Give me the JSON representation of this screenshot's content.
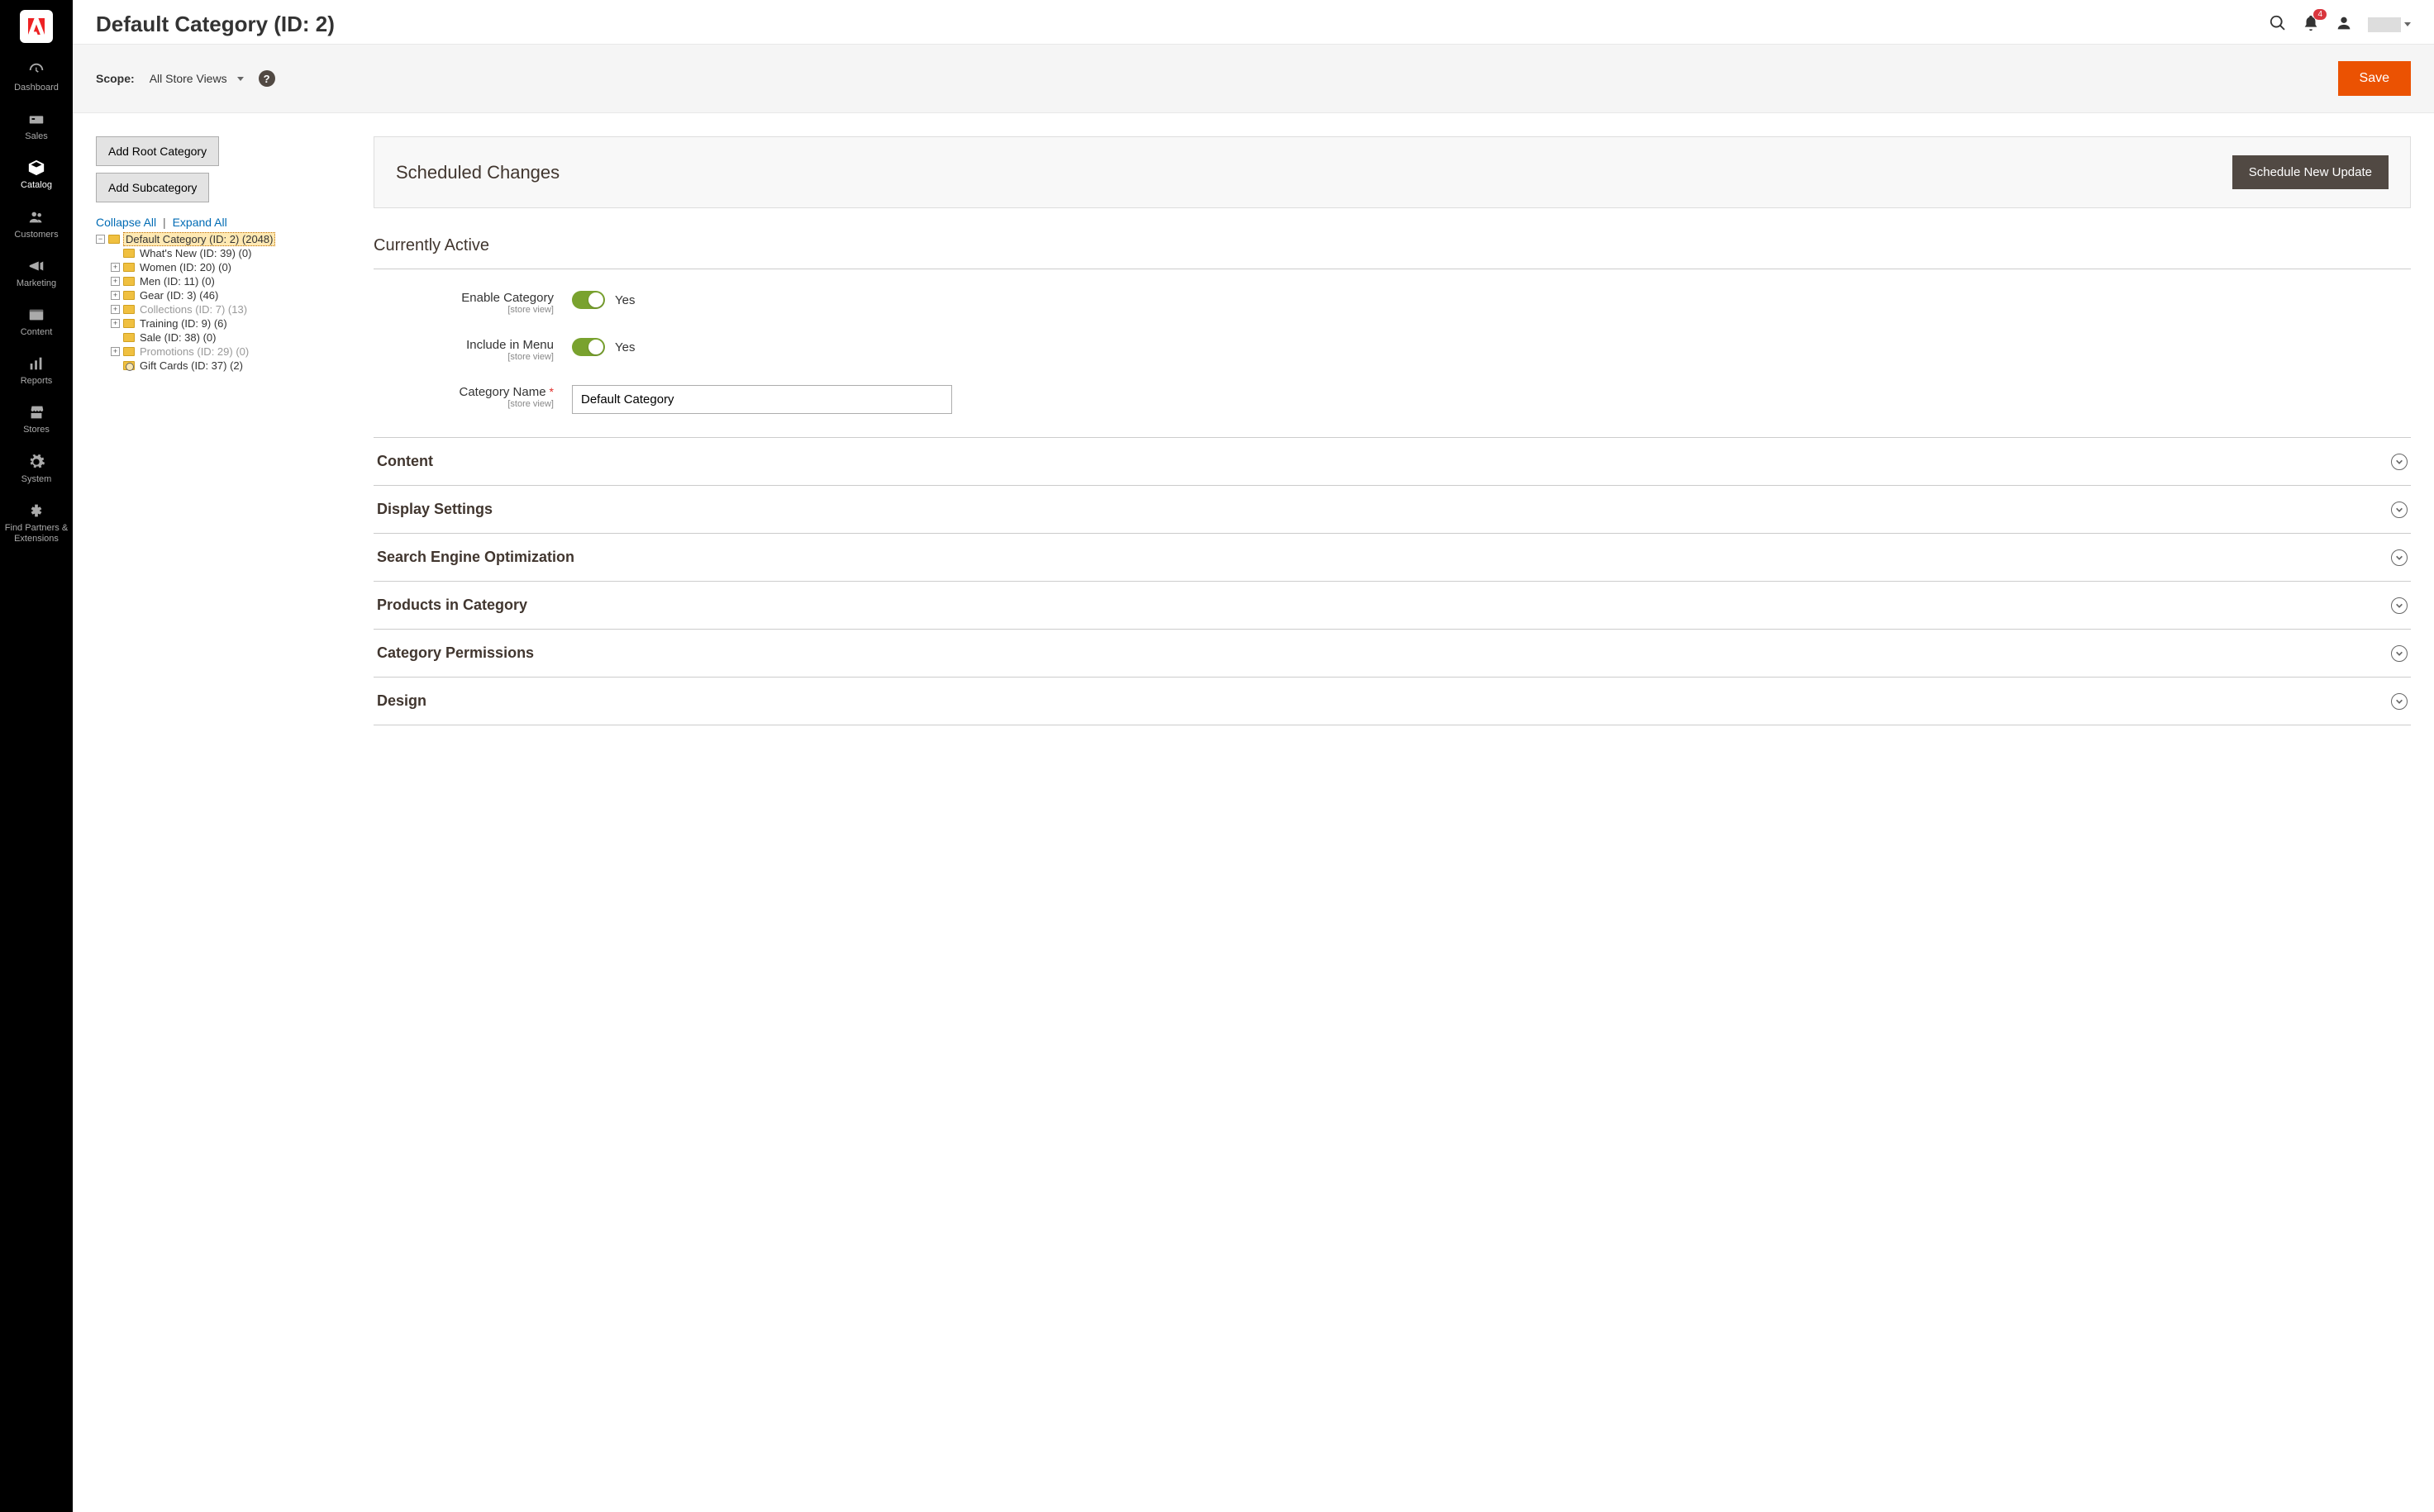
{
  "sidebar": {
    "items": [
      {
        "id": "dashboard",
        "label": "Dashboard"
      },
      {
        "id": "sales",
        "label": "Sales"
      },
      {
        "id": "catalog",
        "label": "Catalog",
        "active": true
      },
      {
        "id": "customers",
        "label": "Customers"
      },
      {
        "id": "marketing",
        "label": "Marketing"
      },
      {
        "id": "content",
        "label": "Content"
      },
      {
        "id": "reports",
        "label": "Reports"
      },
      {
        "id": "stores",
        "label": "Stores"
      },
      {
        "id": "system",
        "label": "System"
      },
      {
        "id": "partners",
        "label": "Find Partners & Extensions"
      }
    ]
  },
  "header": {
    "title": "Default Category (ID: 2)",
    "notifications_count": "4"
  },
  "scope": {
    "label": "Scope:",
    "value": "All Store Views",
    "save_label": "Save"
  },
  "tree_actions": {
    "add_root": "Add Root Category",
    "add_sub": "Add Subcategory",
    "collapse_all": "Collapse All",
    "expand_all": "Expand All"
  },
  "tree": {
    "root": {
      "label": "Default Category (ID: 2) (2048)",
      "selected": true
    },
    "children": [
      {
        "label": "What's New (ID: 39) (0)",
        "expandable": false
      },
      {
        "label": "Women (ID: 20) (0)",
        "expandable": true
      },
      {
        "label": "Men (ID: 11) (0)",
        "expandable": true
      },
      {
        "label": "Gear (ID: 3) (46)",
        "expandable": true
      },
      {
        "label": "Collections (ID: 7) (13)",
        "expandable": true,
        "disabled": true
      },
      {
        "label": "Training (ID: 9) (6)",
        "expandable": true
      },
      {
        "label": "Sale (ID: 38) (0)",
        "expandable": false
      },
      {
        "label": "Promotions (ID: 29) (0)",
        "expandable": true,
        "disabled": true
      },
      {
        "label": "Gift Cards (ID: 37) (2)",
        "expandable": false,
        "search": true
      }
    ]
  },
  "scheduled": {
    "title": "Scheduled Changes",
    "button": "Schedule New Update"
  },
  "active_section": {
    "title": "Currently Active",
    "fields": {
      "enable": {
        "label": "Enable Category",
        "scope": "[store view]",
        "value_text": "Yes"
      },
      "menu": {
        "label": "Include in Menu",
        "scope": "[store view]",
        "value_text": "Yes"
      },
      "name": {
        "label": "Category Name",
        "scope": "[store view]",
        "value": "Default Category"
      }
    }
  },
  "accordion": [
    {
      "title": "Content"
    },
    {
      "title": "Display Settings"
    },
    {
      "title": "Search Engine Optimization"
    },
    {
      "title": "Products in Category"
    },
    {
      "title": "Category Permissions"
    },
    {
      "title": "Design"
    }
  ]
}
